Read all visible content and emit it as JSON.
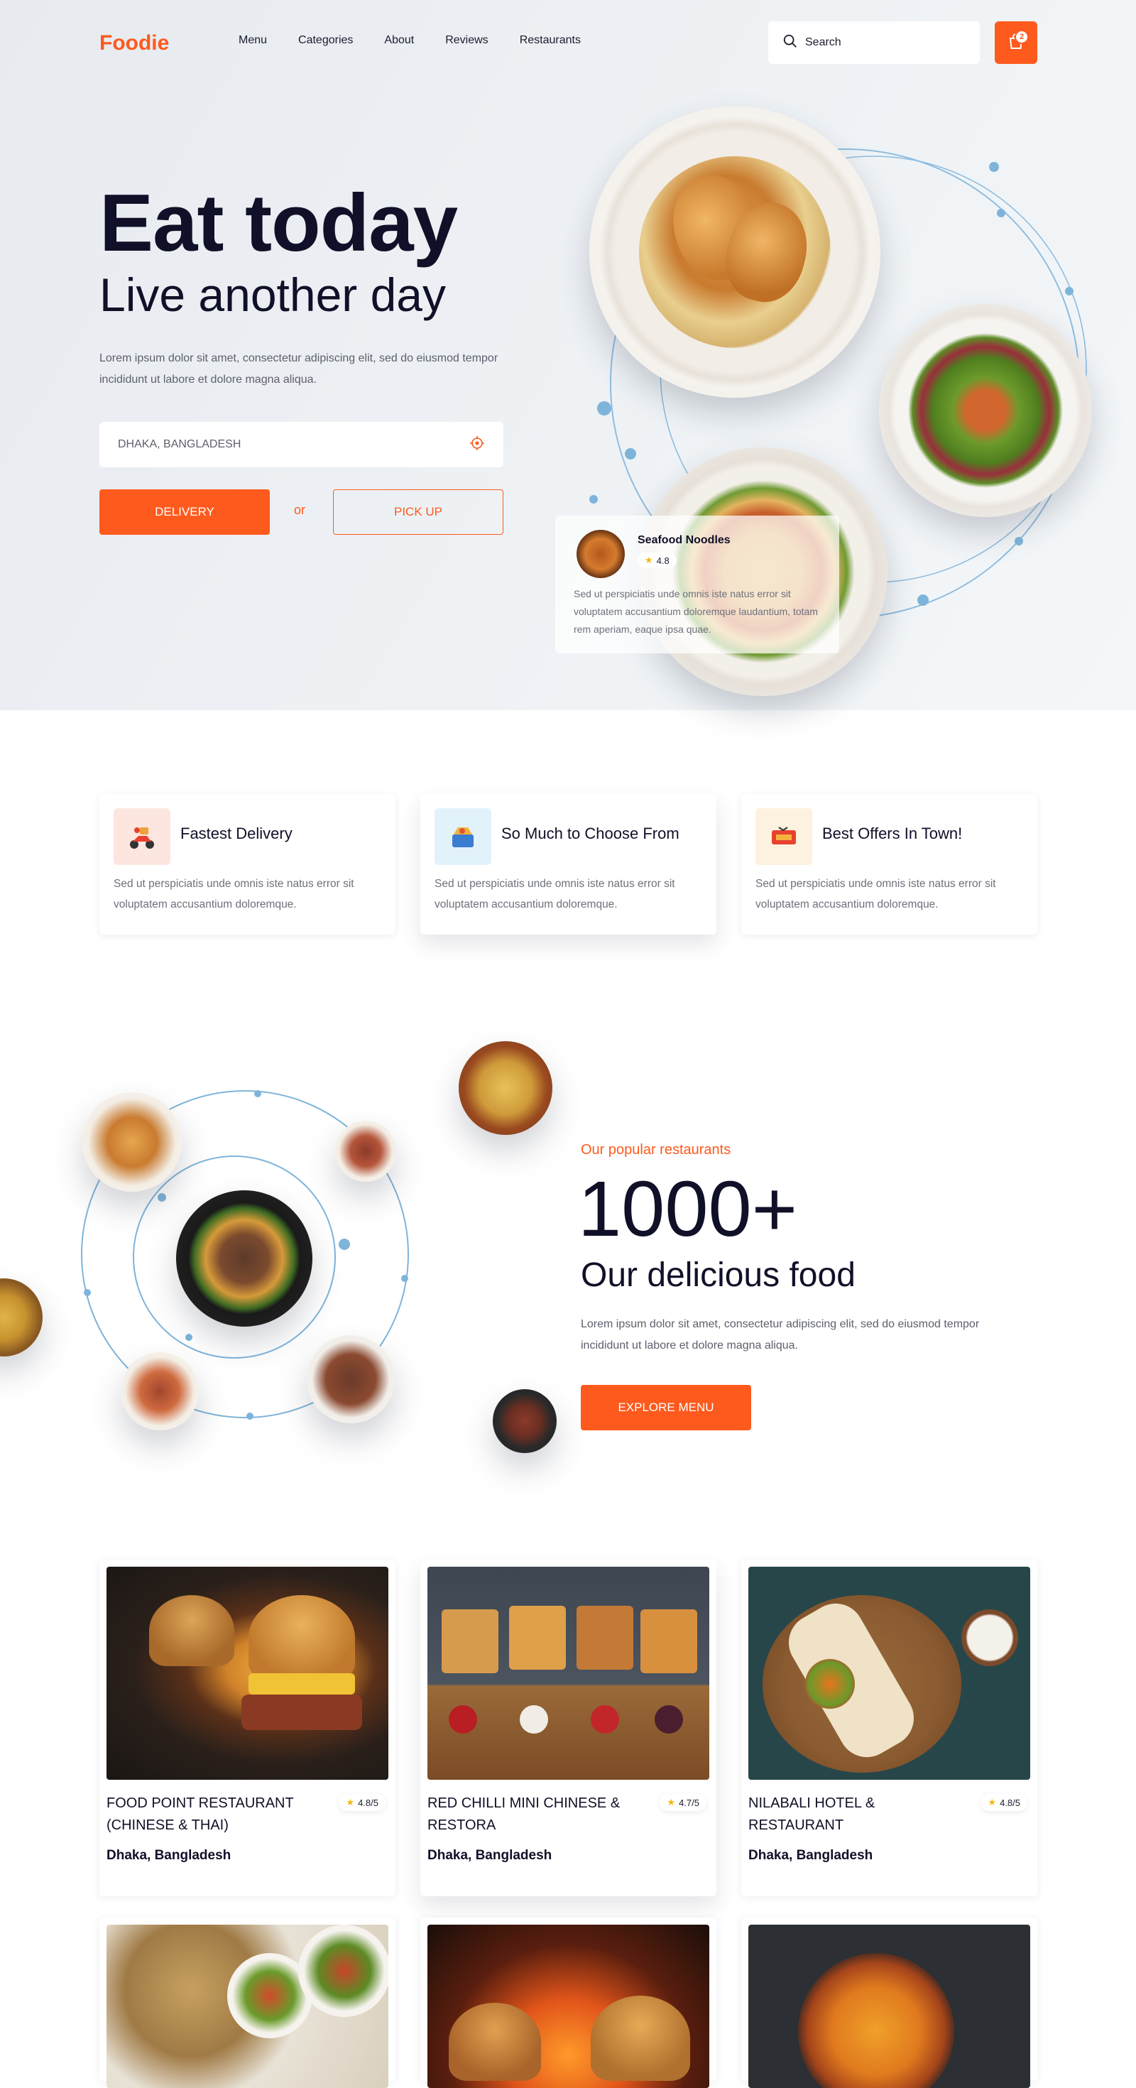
{
  "header": {
    "logo": "Foodie",
    "nav": [
      "Menu",
      "Categories",
      "About",
      "Reviews",
      "Restaurants"
    ],
    "search_placeholder": "Search",
    "cart_count": "2"
  },
  "hero": {
    "title": "Eat today",
    "subtitle": "Live another day",
    "description": "Lorem ipsum dolor sit amet, consectetur adipiscing elit, sed do eiusmod tempor incididunt ut labore et dolore magna aliqua.",
    "location_value": "DHAKA, BANGLADESH",
    "delivery_label": "DELIVERY",
    "or_label": "or",
    "pickup_label": "PICK UP",
    "popup": {
      "name": "Seafood Noodles",
      "rating": "4.8",
      "text": "Sed ut perspiciatis unde omnis iste natus error sit voluptatem accusantium doloremque laudantium, totam rem aperiam, eaque ipsa quae."
    }
  },
  "features": [
    {
      "title": "Fastest  Delivery",
      "text": "Sed ut perspiciatis unde omnis iste natus error sit voluptatem accusantium doloremque.",
      "icon": "scooter-icon"
    },
    {
      "title": "So Much to Choose From",
      "text": "Sed ut perspiciatis unde omnis iste natus error sit voluptatem accusantium doloremque.",
      "icon": "food-box-icon"
    },
    {
      "title": "Best Offers In Town!",
      "text": "Sed ut perspiciatis unde omnis iste natus error sit voluptatem accusantium doloremque.",
      "icon": "offer-tag-icon"
    }
  ],
  "popular": {
    "label": "Our popular restaurants",
    "number": "1000+",
    "subtitle": "Our delicious food",
    "description": "Lorem ipsum dolor sit amet, consectetur adipiscing elit, sed do eiusmod tempor incididunt ut labore et dolore magna aliqua.",
    "button": "EXPLORE MENU"
  },
  "restaurants": [
    {
      "name": "FOOD POINT RESTAURANT (CHINESE & THAI)",
      "rating": "4.8/5",
      "location": "Dhaka, Bangladesh"
    },
    {
      "name": "RED CHILLI MINI CHINESE & RESTORA",
      "rating": "4.7/5",
      "location": "Dhaka, Bangladesh"
    },
    {
      "name": "NILABALI HOTEL & RESTAURANT",
      "rating": "4.8/5",
      "location": "Dhaka, Bangladesh"
    }
  ],
  "colors": {
    "accent": "#fe5a1d",
    "dark": "#101028",
    "orbit": "#7fb4da"
  }
}
